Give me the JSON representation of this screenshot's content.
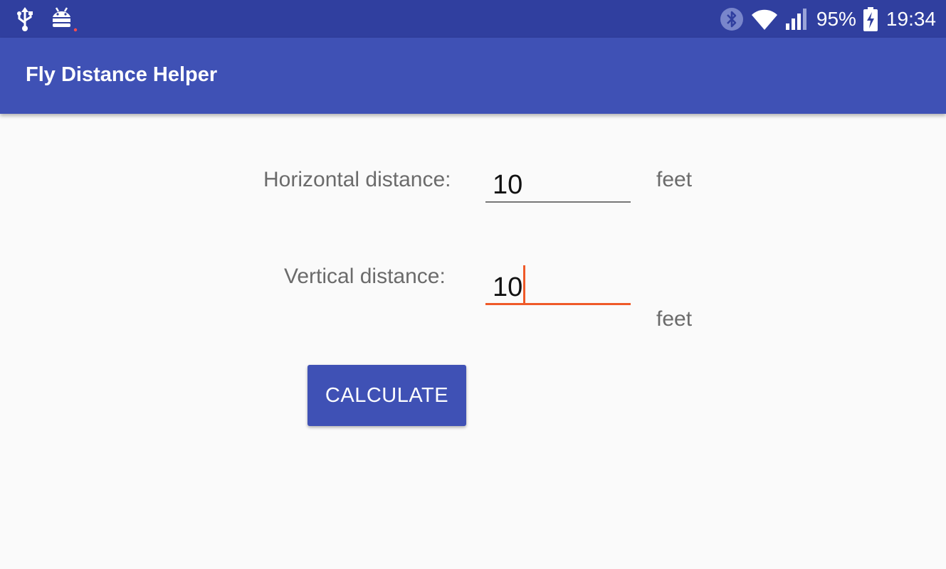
{
  "status_bar": {
    "left_icons": [
      "usb-icon",
      "android-debug-icon"
    ],
    "right_icons": [
      "bluetooth-icon",
      "wifi-icon",
      "signal-icon",
      "battery-charging-icon"
    ],
    "battery": "95%",
    "time": "19:34",
    "background_color": "#303f9f"
  },
  "app_bar": {
    "title": "Fly Distance Helper",
    "background_color": "#3f51b5"
  },
  "form": {
    "horizontal": {
      "label": "Horizontal distance:",
      "value": "10",
      "unit": "feet"
    },
    "vertical": {
      "label": "Vertical distance:",
      "value": "10",
      "unit": "feet",
      "focused": true
    },
    "accent_color": "#ef5a29"
  },
  "calculate_button": {
    "label": "CALCULATE"
  }
}
